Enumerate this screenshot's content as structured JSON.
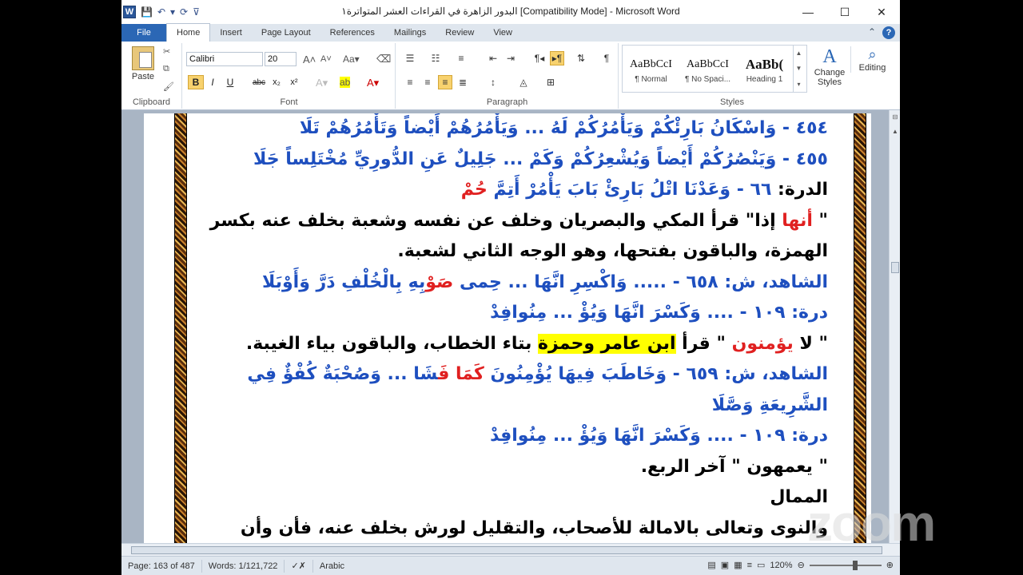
{
  "window": {
    "title": "البدور الزاهرة في القراءات العشر المتواترة١ [Compatibility Mode] - Microsoft Word",
    "app_icon": "W",
    "controls": {
      "minimize": "—",
      "maximize": "☐",
      "close": "✕"
    }
  },
  "tabs": [
    "File",
    "Home",
    "Insert",
    "Page Layout",
    "References",
    "Mailings",
    "Review",
    "View"
  ],
  "active_tab": "Home",
  "ribbon": {
    "clipboard": {
      "paste": "Paste",
      "label": "Clipboard"
    },
    "font": {
      "family": "Calibri",
      "size": "20",
      "label": "Font",
      "bold": "B",
      "italic": "I",
      "underline": "U",
      "strike": "abc",
      "sub": "x₂",
      "sup": "x²"
    },
    "paragraph": {
      "label": "Paragraph"
    },
    "styles": {
      "label": "Styles",
      "items": [
        {
          "preview": "AaBbCcI",
          "name": "¶ Normal"
        },
        {
          "preview": "AaBbCcI",
          "name": "¶ No Spaci..."
        },
        {
          "preview": "AaBb(",
          "name": "Heading 1"
        }
      ],
      "change_styles": "Change Styles",
      "editing": "Editing"
    }
  },
  "document": {
    "lines": [
      {
        "segments": [
          {
            "t": "٤٥٤ - وَاسْكَانُ بَارِئْكُمْ وَيَأْمُرُكُمْ لَهُ ... وَيَأْمُرُهُمْ أَيْضاً وَتَأْمُرُهُمْ تَلَا",
            "c": "blue"
          }
        ]
      },
      {
        "segments": [
          {
            "t": "٤٥٥ - وَيَنْصُرُكُمْ أَيْضاً وَيُشْعِرُكُمْ وَكَمْ ... جَلِيلٌ عَنِ الدُّورِيِّ مُخْتَلِساً جَلَا",
            "c": "blue"
          }
        ]
      },
      {
        "segments": [
          {
            "t": "الدرة: ",
            "c": "black"
          },
          {
            "t": "٦٦ - وَعَدْنَا اتْلُ بَارِئْ بَابَ يَأْمُرْ أَتِمَّ ",
            "c": "blue"
          },
          {
            "t": "حُمْ",
            "c": "red"
          }
        ]
      },
      {
        "segments": [
          {
            "t": "\" ",
            "c": "black"
          },
          {
            "t": "أنها",
            "c": "red"
          },
          {
            "t": " إذا\" قرأ المكي والبصريان وخلف عن نفسه وشعبة بخلف عنه بكسر",
            "c": "black"
          }
        ]
      },
      {
        "segments": [
          {
            "t": "الهمزة، والباقون بفتحها، وهو الوجه الثاني لشعبة.",
            "c": "black"
          }
        ]
      },
      {
        "segments": [
          {
            "t": "الشاهد، ش: ٦٥٨ - ..... وَاكْسِرِ انَّهَا ... حِمى ",
            "c": "blue"
          },
          {
            "t": "صَوْ",
            "c": "red"
          },
          {
            "t": "بِهِ بِالْخُلْفِ دَرَّ وَأَوْبَلَا",
            "c": "blue"
          }
        ]
      },
      {
        "segments": [
          {
            "t": "درة: ١٠٩ - .... وَكَسْرَ انَّهَا وَيُؤْ ... مِنُوافِدْ",
            "c": "blue"
          }
        ]
      },
      {
        "segments": [
          {
            "t": "\" لا ",
            "c": "black"
          },
          {
            "t": "يؤمنون",
            "c": "red"
          },
          {
            "t": " \" قرأ ",
            "c": "black"
          },
          {
            "t": "ابن عامر وحمزة",
            "c": "black",
            "hl": true
          },
          {
            "t": " بتاء الخطاب، والباقون بياء الغيبة.",
            "c": "black"
          }
        ]
      },
      {
        "segments": [
          {
            "t": "الشاهد، ش: ٦٥٩ - وَخَاطَبَ فِيهَا يُؤْمِنُونَ ",
            "c": "blue"
          },
          {
            "t": "كَمَا",
            "c": "red"
          },
          {
            "t": " ",
            "c": "blue"
          },
          {
            "t": "فَ",
            "c": "red"
          },
          {
            "t": "شَا ... وَصُحْبَةٌ كُفْؤٌ فِي",
            "c": "blue"
          }
        ]
      },
      {
        "segments": [
          {
            "t": "الشَّرِيعَةِ وَصَّلَا",
            "c": "blue"
          }
        ]
      },
      {
        "segments": [
          {
            "t": "درة: ١٠٩ - .... وَكَسْرَ انَّهَا وَيُؤْ ... مِنُوافِدْ",
            "c": "blue"
          }
        ]
      },
      {
        "segments": [
          {
            "t": "\" يعمهون \" آخر الربع.",
            "c": "black"
          }
        ]
      },
      {
        "segments": [
          {
            "t": "الممال",
            "c": "black"
          }
        ]
      },
      {
        "segments": [
          {
            "t": "والنوى وتعالى بالامالة للأصحاب، والتقليل لورش بخلف عنه، فأن وأن",
            "c": "black"
          }
        ]
      }
    ]
  },
  "status": {
    "page": "Page: 163 of 487",
    "words": "Words: 1/121,722",
    "language": "Arabic",
    "zoom": "120%"
  },
  "watermark": "zoom",
  "colors": {
    "blue_text": "#1e4fbf",
    "red_text": "#e02020",
    "highlight": "#ffff00",
    "file_tab": "#2b67b5"
  }
}
